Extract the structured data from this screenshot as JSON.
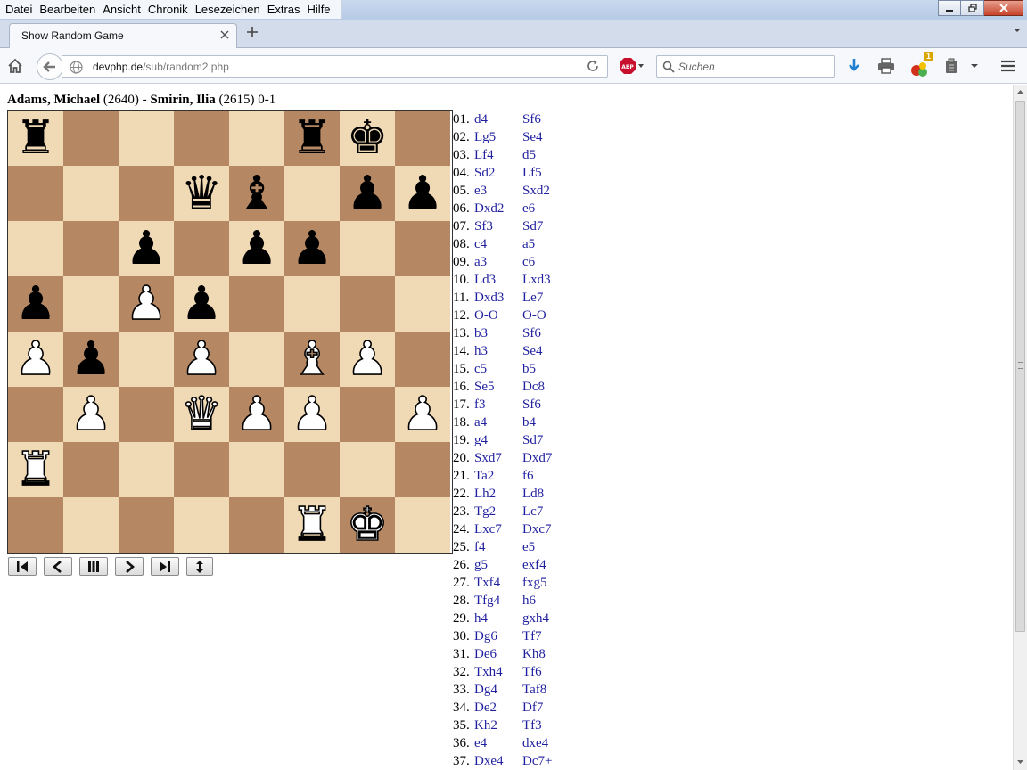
{
  "menubar": {
    "items": [
      "Datei",
      "Bearbeiten",
      "Ansicht",
      "Chronik",
      "Lesezeichen",
      "Extras",
      "Hilfe"
    ]
  },
  "tab": {
    "title": "Show Random Game"
  },
  "url": {
    "host": "devphp.de",
    "path": "/sub/random2.php"
  },
  "search": {
    "placeholder": "Suchen"
  },
  "addon_badge": "1",
  "game": {
    "white_name": "Adams, Michael",
    "white_rating": "(2640)",
    "separator": "-",
    "black_name": "Smirin, Ilia",
    "black_rating": "(2615)",
    "result": "0-1"
  },
  "board": [
    [
      "r",
      "",
      "",
      "",
      "",
      "r",
      "k",
      ""
    ],
    [
      "",
      "",
      "",
      "q",
      "b",
      "",
      "p",
      "p"
    ],
    [
      "",
      "",
      "p",
      "",
      "p",
      "p",
      "",
      ""
    ],
    [
      "p",
      "",
      "P",
      "p",
      "",
      "",
      "",
      ""
    ],
    [
      "P",
      "p",
      "",
      "P",
      "",
      "B",
      "P",
      ""
    ],
    [
      "",
      "P",
      "",
      "Q",
      "P",
      "P",
      "",
      "P"
    ],
    [
      "R",
      "",
      "",
      "",
      "",
      "",
      "",
      ""
    ],
    [
      "",
      "",
      "",
      "",
      "",
      "R",
      "K",
      ""
    ]
  ],
  "moves": [
    [
      "01.",
      "d4",
      "Sf6"
    ],
    [
      "02.",
      "Lg5",
      "Se4"
    ],
    [
      "03.",
      "Lf4",
      "d5"
    ],
    [
      "04.",
      "Sd2",
      "Lf5"
    ],
    [
      "05.",
      "e3",
      "Sxd2"
    ],
    [
      "06.",
      "Dxd2",
      "e6"
    ],
    [
      "07.",
      "Sf3",
      "Sd7"
    ],
    [
      "08.",
      "c4",
      "a5"
    ],
    [
      "09.",
      "a3",
      "c6"
    ],
    [
      "10.",
      "Ld3",
      "Lxd3"
    ],
    [
      "11.",
      "Dxd3",
      "Le7"
    ],
    [
      "12.",
      "O-O",
      "O-O"
    ],
    [
      "13.",
      "b3",
      "Sf6"
    ],
    [
      "14.",
      "h3",
      "Se4"
    ],
    [
      "15.",
      "c5",
      "b5"
    ],
    [
      "16.",
      "Se5",
      "Dc8"
    ],
    [
      "17.",
      "f3",
      "Sf6"
    ],
    [
      "18.",
      "a4",
      "b4"
    ],
    [
      "19.",
      "g4",
      "Sd7"
    ],
    [
      "20.",
      "Sxd7",
      "Dxd7"
    ],
    [
      "21.",
      "Ta2",
      "f6"
    ],
    [
      "22.",
      "Lh2",
      "Ld8"
    ],
    [
      "23.",
      "Tg2",
      "Lc7"
    ],
    [
      "24.",
      "Lxc7",
      "Dxc7"
    ],
    [
      "25.",
      "f4",
      "e5"
    ],
    [
      "26.",
      "g5",
      "exf4"
    ],
    [
      "27.",
      "Txf4",
      "fxg5"
    ],
    [
      "28.",
      "Tfg4",
      "h6"
    ],
    [
      "29.",
      "h4",
      "gxh4"
    ],
    [
      "30.",
      "Dg6",
      "Tf7"
    ],
    [
      "31.",
      "De6",
      "Kh8"
    ],
    [
      "32.",
      "Txh4",
      "Tf6"
    ],
    [
      "33.",
      "Dg4",
      "Taf8"
    ],
    [
      "34.",
      "De2",
      "Df7"
    ],
    [
      "35.",
      "Kh2",
      "Tf3"
    ],
    [
      "36.",
      "e4",
      "dxe4"
    ],
    [
      "37.",
      "Dxe4",
      "Dc7+"
    ]
  ]
}
